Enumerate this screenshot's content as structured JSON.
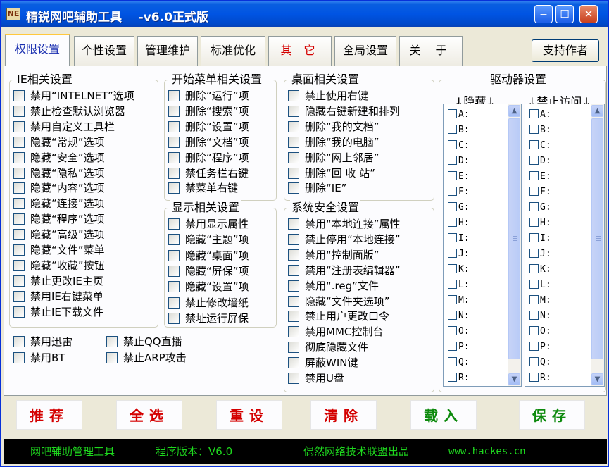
{
  "window": {
    "title": "精锐网吧辅助工具    -v6.0正式版",
    "icon_text": "NE",
    "min": "‒",
    "max": "☐",
    "close": "✕"
  },
  "tabs": [
    {
      "label": "权限设置",
      "active": true
    },
    {
      "label": "个性设置"
    },
    {
      "label": "管理维护"
    },
    {
      "label": "标准优化"
    },
    {
      "label": "其 它",
      "highlight": true
    },
    {
      "label": "全局设置"
    },
    {
      "label": "关 于"
    }
  ],
  "support_button": "支持作者",
  "groups": {
    "ie": {
      "title": "IE相关设置",
      "items": [
        "禁用“INTELNET”选项",
        "禁止检查默认浏览器",
        "禁用自定义工具栏",
        "隐藏“常规”选项",
        "隐藏“安全”选项",
        "隐藏“隐私”选项",
        "隐藏“内容”选项",
        "隐藏“连接”选项",
        "隐藏“程序”选项",
        "隐藏“高级”选项",
        "隐藏“文件”菜单",
        "隐藏“收藏”按钮",
        "禁止更改IE主页",
        "禁用IE右键菜单",
        "禁止IE下载文件"
      ]
    },
    "startmenu": {
      "title": "开始菜单相关设置",
      "items": [
        "删除“运行”项",
        "删除“搜索”项",
        "删除“设置”项",
        "删除“文档”项",
        "删除“程序”项",
        "禁任务栏右键",
        "禁菜单右键"
      ]
    },
    "display": {
      "title": "显示相关设置",
      "items": [
        "禁用显示属性",
        "隐藏“主题”项",
        "隐藏“桌面”项",
        "隐藏“屏保”项",
        "隐藏“设置”项",
        "禁止修改墙纸",
        "禁址运行屏保"
      ]
    },
    "desktop": {
      "title": "桌面相关设置",
      "items": [
        "禁止使用右键",
        "隐藏右键新建和排列",
        "删除“我的文档”",
        "删除“我的电脑”",
        "删除“网上邻居”",
        "删除“回 收 站”",
        "删除“IE”"
      ]
    },
    "security": {
      "title": "系统安全设置",
      "items": [
        "禁用“本地连接”属性",
        "禁止停用“本地连接”",
        "禁用“控制面版”",
        "禁用“注册表编辑器”",
        "禁用“.reg”文件",
        "隐藏“文件夹选项”",
        "禁止用户更改口令",
        "禁用MMC控制台",
        "彻底隐藏文件",
        "屏蔽WIN键",
        "禁用U盘"
      ]
    },
    "loose": [
      "禁用迅雷",
      "禁止QQ直播",
      "禁用BT",
      "禁止ARP攻击"
    ],
    "drives": {
      "title": "驱动器设置",
      "hide_label": "↓隐藏↓",
      "deny_label": "↓禁止访问↓",
      "items": [
        "A:",
        "B:",
        "C:",
        "D:",
        "E:",
        "F:",
        "G:",
        "H:",
        "I:",
        "J:",
        "K:",
        "L:",
        "M:",
        "N:",
        "O:",
        "P:",
        "Q:",
        "R:"
      ]
    }
  },
  "actions": [
    "推荐",
    "全选",
    "重设",
    "清除",
    "载入",
    "保存"
  ],
  "status": {
    "app": "网吧辅助管理工具",
    "version": "程序版本：V6.0",
    "publisher": "偶然网络技术联盟出品",
    "site": "www.hackes.cn"
  }
}
